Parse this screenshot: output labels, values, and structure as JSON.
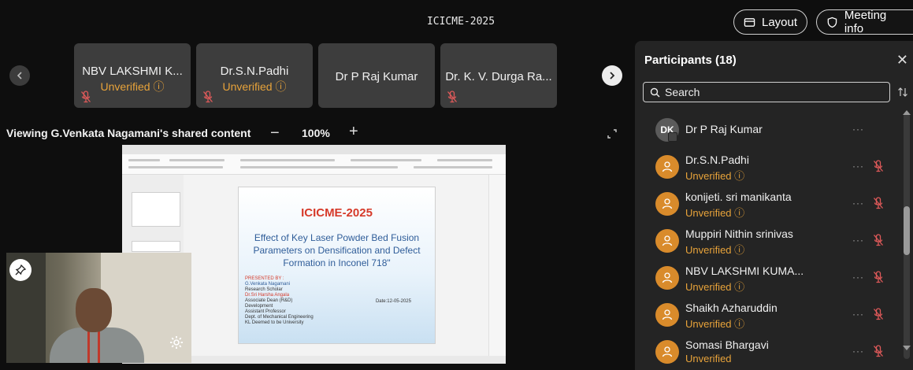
{
  "meeting": {
    "title": "ICICME-2025"
  },
  "top_buttons": {
    "layout_label": "Layout",
    "meeting_info_label": "Meeting info"
  },
  "tiles": [
    {
      "name": "NBV LAKSHMI K...",
      "status": "Unverified"
    },
    {
      "name": "Dr.S.N.Padhi",
      "status": "Unverified"
    },
    {
      "name": "Dr P Raj Kumar",
      "status": ""
    },
    {
      "name": "Dr. K. V. Durga Ra...",
      "status": ""
    }
  ],
  "share": {
    "viewing_label": "Viewing G.Venkata Nagamani's shared content",
    "zoom_minus": "−",
    "zoom": "100%",
    "zoom_plus": "+"
  },
  "slide": {
    "title": "ICICME-2025",
    "subtitle": "Effect of Key Laser Powder Bed Fusion Parameters on Densification and Defect Formation in Inconel 718\"",
    "presented_by": "PRESENTED BY :",
    "presenter": "G.Venkata Nagamani",
    "presenter_role": "Research Scholar",
    "guide": "Dr.Sri Harsha Angala",
    "guide_details": [
      "Associate Dean (R&D)",
      "Development",
      "Assistant Professor",
      "Dept. of Mechanical Engineering",
      "KL Deemed to be University"
    ],
    "date": "Date:12-05-2025"
  },
  "participants": {
    "title": "Participants (18)",
    "search_placeholder": "Search",
    "list": [
      {
        "name": "Dr P Raj Kumar",
        "initials": "DK",
        "status": ""
      },
      {
        "name": "Dr.S.N.Padhi",
        "initials": "",
        "status": "Unverified"
      },
      {
        "name": "konijeti. sri manikanta",
        "initials": "",
        "status": "Unverified"
      },
      {
        "name": "Muppiri Nithin srinivas",
        "initials": "",
        "status": "Unverified"
      },
      {
        "name": "NBV LAKSHMI KUMA...",
        "initials": "",
        "status": "Unverified"
      },
      {
        "name": "Shaikh Azharuddin",
        "initials": "",
        "status": "Unverified"
      },
      {
        "name": "Somasi Bhargavi",
        "initials": "",
        "status": "Unverified"
      }
    ]
  },
  "colors": {
    "unverified": "#e8a33a",
    "tile_bg": "#3d3d3d",
    "panel_bg": "#242424",
    "avatar": "#d98b2b",
    "mic_off": "#e05a5a"
  }
}
